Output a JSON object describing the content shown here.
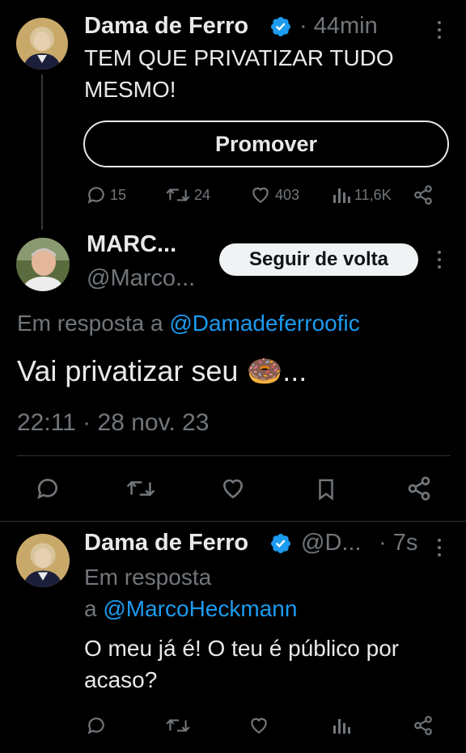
{
  "tweet1": {
    "name": "Dama de Ferro",
    "time": "· 44min",
    "text": "TEM QUE PRIVATIZAR TUDO MESMO!",
    "promote_label": "Promover",
    "stats": {
      "replies": "15",
      "retweets": "24",
      "likes": "403",
      "views": "11,6K"
    }
  },
  "tweet2": {
    "name": "MARC...",
    "handle": "@Marco...",
    "follow_label": "Seguir de volta",
    "reply_prefix": "Em resposta a ",
    "reply_to": "@Damadeferroofic",
    "text": "Vai privatizar seu ",
    "text_after_emoji": "...",
    "emoji": "🍩",
    "timestamp": "22:11 · 28 nov. 23"
  },
  "tweet3": {
    "name": "Dama de Ferro",
    "handle": "@D...",
    "time": "· 7s",
    "reply_prefix_line1": "Em resposta",
    "reply_prefix_line2": "a ",
    "reply_to": "@MarcoHeckmann",
    "text": "O meu já é! O teu é público por acaso?"
  },
  "colors": {
    "background": "#000000",
    "text": "#e7e9ea",
    "muted": "#71767b",
    "link": "#1d9bf0",
    "verified": "#1d9bf0"
  },
  "icons": [
    "reply-icon",
    "retweet-icon",
    "like-icon",
    "views-icon",
    "share-icon",
    "bookmark-icon",
    "verified-badge-icon",
    "more-icon"
  ]
}
